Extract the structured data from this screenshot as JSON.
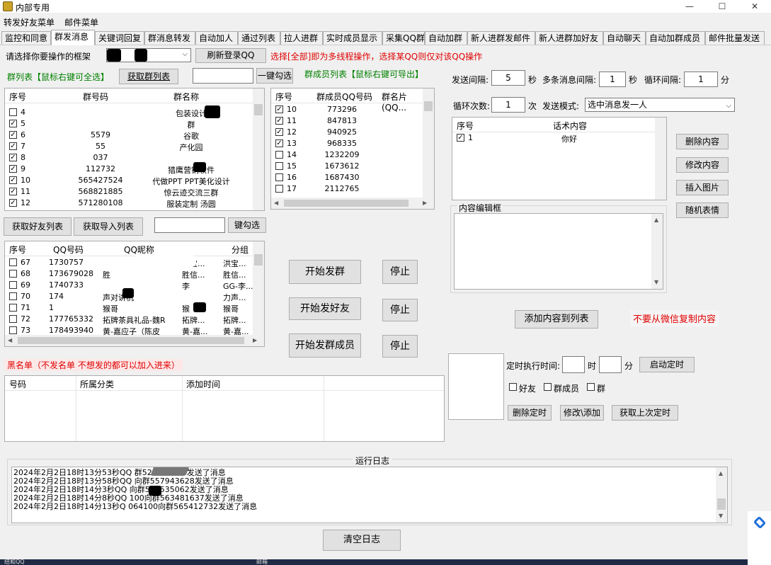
{
  "window": {
    "title": "内部专用",
    "minimize": "—",
    "maximize": "☐",
    "close": "✕"
  },
  "menu": [
    "转发好友菜单",
    "邮件菜单"
  ],
  "tabs": [
    "监控和同意",
    "群发消息",
    "关键词回复",
    "群消息转发",
    "自动加人",
    "通过列表",
    "拉人进群",
    "实时成员显示",
    "采集QQ群",
    "自动加群",
    "新人进群发邮件",
    "新人进群加好友",
    "自动聊天",
    "自动加群成员",
    "邮件批量发送"
  ],
  "active_tab": "群发消息",
  "top": {
    "select_label": "请选择你要操作的框架",
    "refresh_btn": "刷新登录QQ",
    "hint": "选择[全部]即为多线程操作，选择某QQ则仅对该QQ操作"
  },
  "group_list": {
    "label": "群列表【鼠标右键可全选】",
    "fetch_btn": "获取群列表",
    "select_all_btn": "一键勾选",
    "headers": [
      "序号",
      "群号码",
      "群名称"
    ],
    "rows": [
      {
        "no": "4",
        "code": "17359",
        "name": "包装设计",
        "checked": false
      },
      {
        "no": "5",
        "code": "",
        "name": "群",
        "checked": true
      },
      {
        "no": "6",
        "code": "5579",
        "name": "谷歌",
        "checked": true
      },
      {
        "no": "7",
        "code": "55",
        "name": "产化园",
        "checked": true
      },
      {
        "no": "8",
        "code": "037",
        "name": "",
        "checked": true
      },
      {
        "no": "9",
        "code": "112732",
        "name": "猎鹰营销软件",
        "checked": true
      },
      {
        "no": "10",
        "code": "565427524",
        "name": "代做PPT PPT美化设计",
        "checked": true
      },
      {
        "no": "11",
        "code": "568821885",
        "name": "惊云迹交流三群",
        "checked": true
      },
      {
        "no": "12",
        "code": "571280108",
        "name": "服装定制 汤圆",
        "checked": true
      }
    ]
  },
  "member_list": {
    "label": "群成员列表【鼠标右键可导出】",
    "headers": [
      "序号",
      "群成员QQ号码",
      "群名片(QQ..."
    ],
    "rows": [
      {
        "no": "10",
        "qq": "773296",
        "checked": true
      },
      {
        "no": "11",
        "qq": "847813",
        "checked": true
      },
      {
        "no": "12",
        "qq": "940925",
        "checked": true
      },
      {
        "no": "13",
        "qq": "968335",
        "checked": true
      },
      {
        "no": "14",
        "qq": "1232209",
        "checked": false
      },
      {
        "no": "15",
        "qq": "1673612",
        "checked": false
      },
      {
        "no": "16",
        "qq": "1687430",
        "checked": false
      },
      {
        "no": "17",
        "qq": "2112765",
        "checked": false
      }
    ]
  },
  "friend_list": {
    "fetch_btn": "获取好友列表",
    "import_btn": "获取导入列表",
    "select_all_btn": "键勾选",
    "headers": [
      "序号",
      "QQ号码",
      "QQ昵称",
      "分组"
    ],
    "rows": [
      {
        "no": "67",
        "qq": "1730757",
        "nick": "",
        "c4": "洪宝...",
        "group": "洪宝...",
        "checked": false
      },
      {
        "no": "68",
        "qq": "173679028",
        "nick": "胜",
        "c4": "胜信...",
        "group": "胜信...",
        "checked": false
      },
      {
        "no": "69",
        "qq": "1740733",
        "nick": "",
        "c4": "李",
        "group": "GG-李...",
        "checked": false
      },
      {
        "no": "70",
        "qq": "174",
        "nick": "声对讲机",
        "c4": "",
        "group": "力声...",
        "checked": false
      },
      {
        "no": "71",
        "qq": "1",
        "nick": "猴哥",
        "c4": "猴",
        "group": "猴哥",
        "checked": false
      },
      {
        "no": "72",
        "qq": "177765332",
        "nick": "拓牌茶具礼品-魏R",
        "c4": "拓牌...",
        "group": "拓牌...",
        "checked": false
      },
      {
        "no": "73",
        "qq": "178493940",
        "nick": "黄-嘉应子（陈皮",
        "c4": "黄-嘉...",
        "group": "黄-嘉...",
        "checked": false
      }
    ]
  },
  "actions": {
    "start_group": "开始发群",
    "stop1": "停止",
    "start_friend": "开始发好友",
    "stop2": "停止",
    "start_member": "开始发群成员",
    "stop3": "停止"
  },
  "blacklist": {
    "label": "黑名单（不发名单 不想发的都可以加入进来）",
    "headers": [
      "号码",
      "所属分类",
      "添加时间"
    ]
  },
  "settings": {
    "send_interval_label": "发送间隔:",
    "send_interval": "5",
    "sec1": "秒",
    "multi_interval_label": "多条消息间隔:",
    "multi_interval": "1",
    "sec2": "秒",
    "loop_interval_label": "循环间隔:",
    "loop_interval": "1",
    "min1": "分",
    "loop_count_label": "循环次数:",
    "loop_count": "1",
    "times": "次",
    "mode_label": "发送模式:",
    "mode": "选中消息发一人"
  },
  "scripts": {
    "headers": [
      "序号",
      "话术内容"
    ],
    "rows": [
      {
        "no": "1",
        "text": "你好",
        "checked": true
      }
    ],
    "delete_btn": "删除内容",
    "edit_btn": "修改内容",
    "insert_img_btn": "插入图片",
    "emoji_btn": "随机表情",
    "editor_label": "内容编辑框",
    "add_btn": "添加内容到列表",
    "warning": "不要从微信复制内容"
  },
  "timer": {
    "label": "定时执行时间:",
    "hour": "时",
    "minute": "分",
    "start_btn": "启动定时",
    "opt_friend": "好友",
    "opt_member": "群成员",
    "opt_group": "群",
    "delete_btn": "删除定时",
    "edit_btn": "修改\\添加",
    "last_btn": "获取上次定时"
  },
  "log": {
    "title": "运行日志",
    "lines": [
      "2024年2月2日18时13分53秒QQ            群528875953发送了消息",
      "2024年2月2日18时13分58秒QQ            向群557943628发送了消息",
      "2024年2月2日18时14分3秒QQ              向群558535062发送了消息",
      "2024年2月2日18时14分8秒QQ           100向群563481637发送了消息",
      "2024年2月2日18时14分13秒Q       064100向群565412732发送了消息"
    ],
    "clear_btn": "清空日志"
  },
  "taskbar": {
    "item1": "结和QQ",
    "item2": "邮箱"
  }
}
